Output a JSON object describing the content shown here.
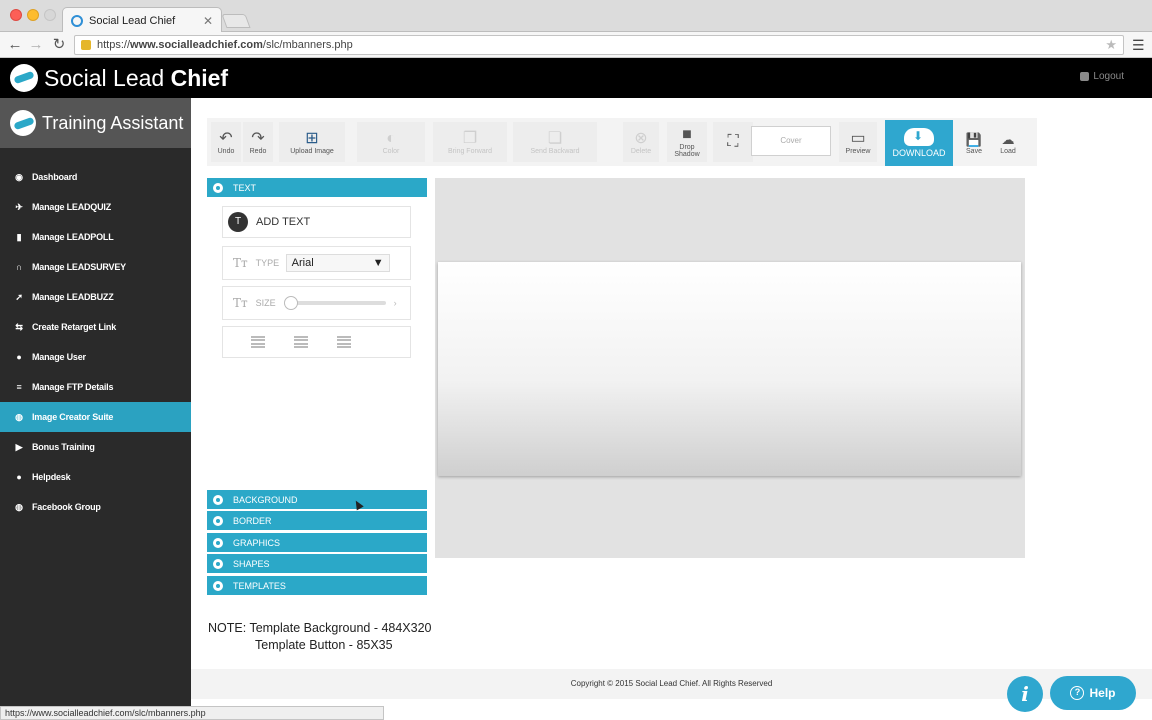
{
  "browser": {
    "tab_title": "Social Lead Chief",
    "url_prefix": "https://",
    "url_domain": "www.socialleadchief.com",
    "url_path": "/slc/mbanners.php",
    "status_url": "https://www.socialleadchief.com/slc/mbanners.php"
  },
  "header": {
    "logo_light": "Social Lead ",
    "logo_bold": "Chief",
    "logout": "Logout"
  },
  "sidebar": {
    "title": "Training Assistant",
    "items": [
      {
        "label": "Dashboard",
        "icon": "◉"
      },
      {
        "label": "Manage LEADQUIZ",
        "icon": "✈"
      },
      {
        "label": "Manage LEADPOLL",
        "icon": "▮"
      },
      {
        "label": "Manage LEADSURVEY",
        "icon": "∩"
      },
      {
        "label": "Manage LEADBUZZ",
        "icon": "➚"
      },
      {
        "label": "Create Retarget Link",
        "icon": "⇆"
      },
      {
        "label": "Manage User",
        "icon": "●"
      },
      {
        "label": "Manage FTP Details",
        "icon": "≡"
      },
      {
        "label": "Image Creator Suite",
        "icon": "◍"
      },
      {
        "label": "Bonus Training",
        "icon": "▶"
      },
      {
        "label": "Helpdesk",
        "icon": "●"
      },
      {
        "label": "Facebook Group",
        "icon": "◍"
      }
    ],
    "active_index": 8
  },
  "toolbar": {
    "undo": "Undo",
    "redo": "Redo",
    "upload": "Upload Image",
    "color": "Color",
    "bring_forward": "Bring Forward",
    "send_backward": "Send Backward",
    "delete": "Delete",
    "drop_shadow_1": "Drop",
    "drop_shadow_2": "Shadow",
    "cover": "Cover",
    "preview": "Preview",
    "download": "DOWNLOAD",
    "save": "Save",
    "load": "Load"
  },
  "panel": {
    "text_header": "TEXT",
    "add_text": "ADD TEXT",
    "type_label": "TYPE",
    "type_value": "Arial",
    "size_label": "SIZE",
    "size_level": 0,
    "sections": [
      "BACKGROUND",
      "BORDER",
      "GRAPHICS",
      "SHAPES",
      "TEMPLATES"
    ]
  },
  "note": {
    "line1": "NOTE: Template Background - 484X320",
    "line2": "Template Button - 85X35"
  },
  "footer": {
    "copyright": "Copyright © 2015 Social Lead Chief. All Rights Reserved",
    "info": "i",
    "help": "Help"
  }
}
